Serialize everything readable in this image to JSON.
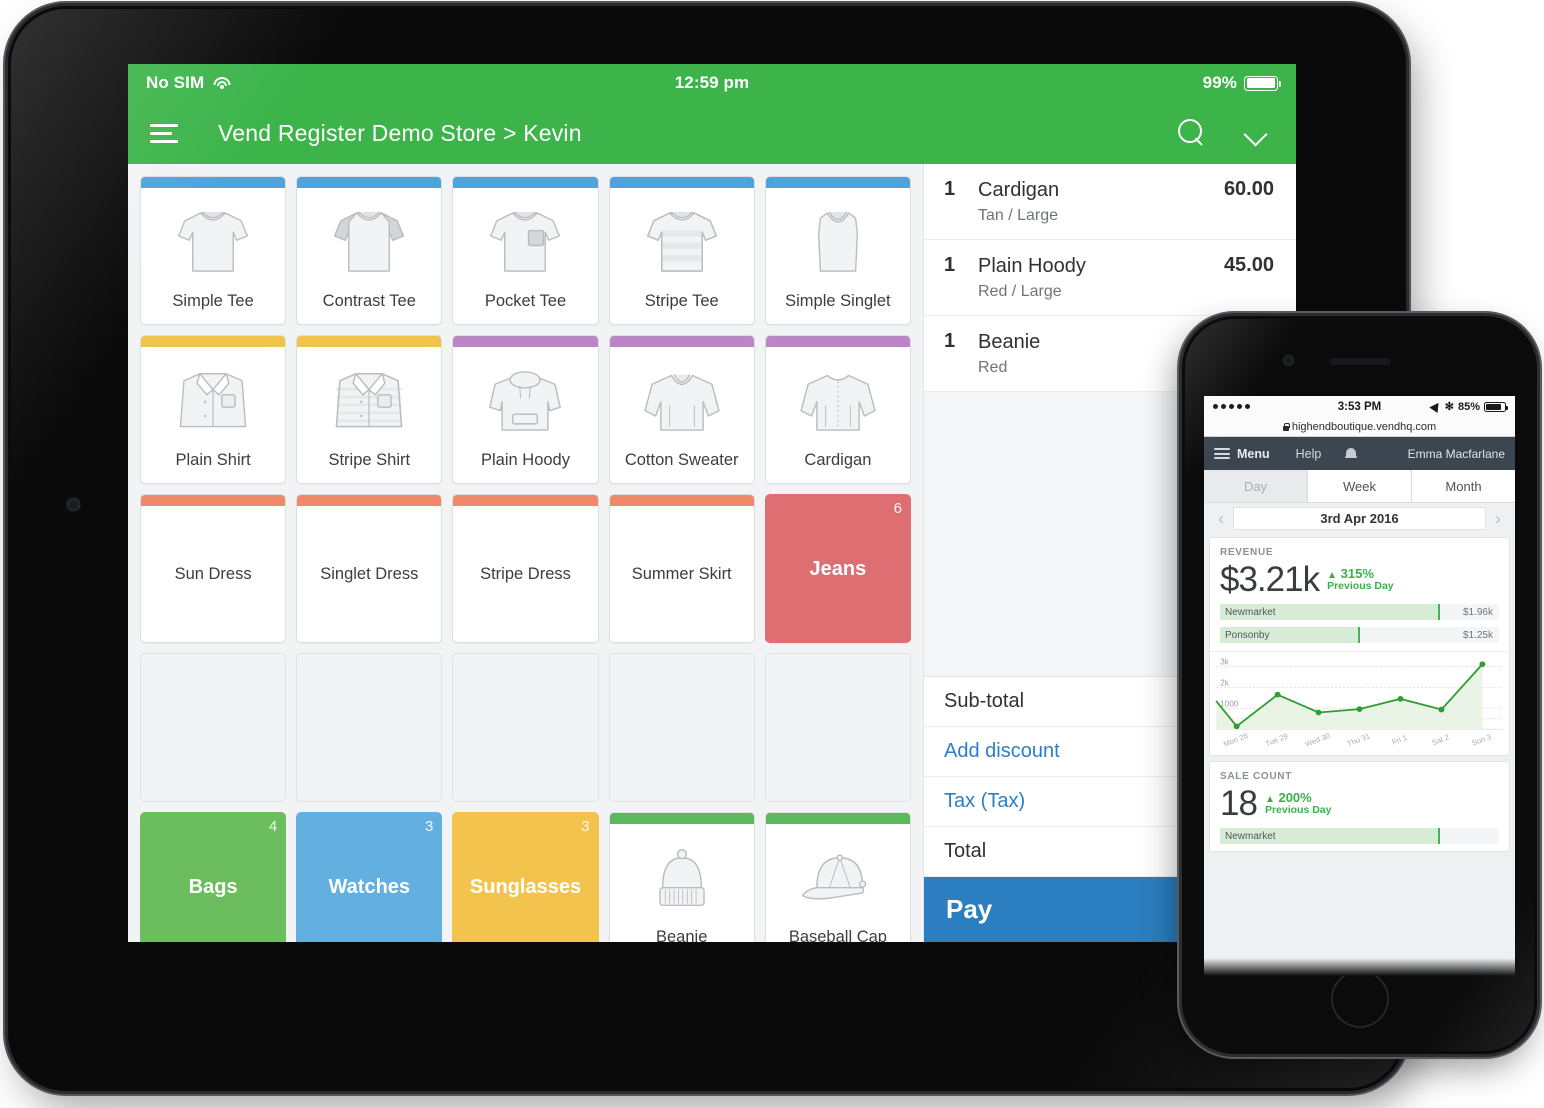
{
  "tablet": {
    "status_bar": {
      "carrier": "No SIM",
      "wifi_icon": "wifi-icon",
      "time": "12:59 pm",
      "battery_pct": "99%"
    },
    "nav": {
      "menu_icon": "hamburger-menu-icon",
      "title": "Vend Register Demo Store > Kevin",
      "search_icon": "search-icon",
      "chevron_icon": "chevron-down-icon"
    },
    "grid": {
      "tiles": [
        {
          "label": "Simple Tee",
          "stripe": "#4fa3dd",
          "art": "tee",
          "type": "product"
        },
        {
          "label": "Contrast Tee",
          "stripe": "#4fa3dd",
          "art": "tee-contrast",
          "type": "product"
        },
        {
          "label": "Pocket Tee",
          "stripe": "#4fa3dd",
          "art": "tee-pocket",
          "type": "product"
        },
        {
          "label": "Stripe Tee",
          "stripe": "#4fa3dd",
          "art": "tee-stripe",
          "type": "product"
        },
        {
          "label": "Simple Singlet",
          "stripe": "#4fa3dd",
          "art": "singlet",
          "type": "product"
        },
        {
          "label": "Plain Shirt",
          "stripe": "#f0c34c",
          "art": "shirt",
          "type": "product"
        },
        {
          "label": "Stripe Shirt",
          "stripe": "#f0c34c",
          "art": "shirt-stripe",
          "type": "product"
        },
        {
          "label": "Plain Hoody",
          "stripe": "#bb86c6",
          "art": "hoody",
          "type": "product"
        },
        {
          "label": "Cotton Sweater",
          "stripe": "#bb86c6",
          "art": "sweater",
          "type": "product"
        },
        {
          "label": "Cardigan",
          "stripe": "#bb86c6",
          "art": "cardigan",
          "type": "product"
        },
        {
          "label": "Sun Dress",
          "stripe": "#f0886b",
          "art": "",
          "type": "product-noart"
        },
        {
          "label": "Singlet Dress",
          "stripe": "#f0886b",
          "art": "",
          "type": "product-noart"
        },
        {
          "label": "Stripe Dress",
          "stripe": "#f0886b",
          "art": "",
          "type": "product-noart"
        },
        {
          "label": "Summer Skirt",
          "stripe": "#f0886b",
          "art": "",
          "type": "product-noart"
        },
        {
          "label": "Jeans",
          "fill": "#dd6e72",
          "count": "6",
          "type": "group"
        },
        {
          "label": "",
          "type": "empty"
        },
        {
          "label": "",
          "type": "empty"
        },
        {
          "label": "",
          "type": "empty"
        },
        {
          "label": "",
          "type": "empty"
        },
        {
          "label": "",
          "type": "empty"
        },
        {
          "label": "Bags",
          "fill": "#6cbd5e",
          "count": "4",
          "type": "group"
        },
        {
          "label": "Watches",
          "fill": "#63b0e0",
          "count": "3",
          "type": "group"
        },
        {
          "label": "Sunglasses",
          "fill": "#f2c44e",
          "count": "3",
          "type": "group"
        },
        {
          "label": "Beanie",
          "stripe": "#5cb85c",
          "art": "beanie",
          "type": "product"
        },
        {
          "label": "Baseball Cap",
          "stripe": "#5cb85c",
          "art": "baseball-cap",
          "type": "product"
        }
      ]
    },
    "cart": {
      "items": [
        {
          "qty": "1",
          "name": "Cardigan",
          "variant": "Tan / Large",
          "price": "60.00"
        },
        {
          "qty": "1",
          "name": "Plain Hoody",
          "variant": "Red / Large",
          "price": "45.00"
        },
        {
          "qty": "1",
          "name": "Beanie",
          "variant": "Red",
          "price": ""
        }
      ],
      "totals": [
        {
          "label": "Sub-total",
          "link": false
        },
        {
          "label": "Add discount",
          "link": true
        },
        {
          "label": "Tax (Tax)",
          "link": true
        },
        {
          "label": "Total",
          "link": false
        }
      ],
      "pay_label": "Pay",
      "pay_color": "#2b7fc0"
    }
  },
  "phone": {
    "status_bar": {
      "signal_icon": "signal-dots-icon",
      "time": "3:53 PM",
      "location_icon": "location-arrow-icon",
      "bluetooth_icon": "bluetooth-icon",
      "battery_pct": "85%"
    },
    "url_bar": {
      "lock_icon": "lock-icon",
      "url": "highendboutique.vendhq.com"
    },
    "nav": {
      "menu_icon": "hamburger-menu-icon",
      "menu_label": "Menu",
      "help_label": "Help",
      "bell_icon": "bell-icon",
      "user": "Emma Macfarlane"
    },
    "segments": [
      {
        "label": "Day",
        "state": "muted"
      },
      {
        "label": "Week",
        "state": "on"
      },
      {
        "label": "Month",
        "state": "on"
      }
    ],
    "date_nav": {
      "prev_icon": "chevron-left-icon",
      "date": "3rd Apr 2016",
      "next_icon": "chevron-right-icon"
    },
    "revenue_card": {
      "title": "REVENUE",
      "value": "$3.21k",
      "delta_pct": "315%",
      "delta_caret": "▲",
      "delta_label": "Previous Day",
      "outlets": [
        {
          "name": "Newmarket",
          "value": "$1.96k",
          "pct": 79
        },
        {
          "name": "Ponsonby",
          "value": "$1.25k",
          "pct": 50
        }
      ]
    },
    "sale_count_card": {
      "title": "SALE COUNT",
      "value": "18",
      "delta_pct": "200%",
      "delta_caret": "▲",
      "delta_label": "Previous Day",
      "outlets": [
        {
          "name": "Newmarket",
          "value": "",
          "pct": 79
        }
      ]
    },
    "chart_data": {
      "type": "line",
      "title": "Revenue",
      "x": [
        "Mon 28",
        "Tue 29",
        "Wed 30",
        "Thu 31",
        "Fri 1",
        "Sat 2",
        "Sun 3"
      ],
      "values": [
        140,
        1650,
        800,
        960,
        1450,
        940,
        3100
      ],
      "start_value": 1350,
      "ytick_labels": [
        "3k",
        "2k",
        "1000"
      ],
      "yticks": [
        3000,
        2000,
        1000
      ],
      "ylim": [
        0,
        3400
      ],
      "xlabel": "",
      "ylabel": "",
      "grid": true,
      "legend": "none",
      "line_color": "#2f9e31",
      "fill_color": "#eaf4e6"
    }
  }
}
